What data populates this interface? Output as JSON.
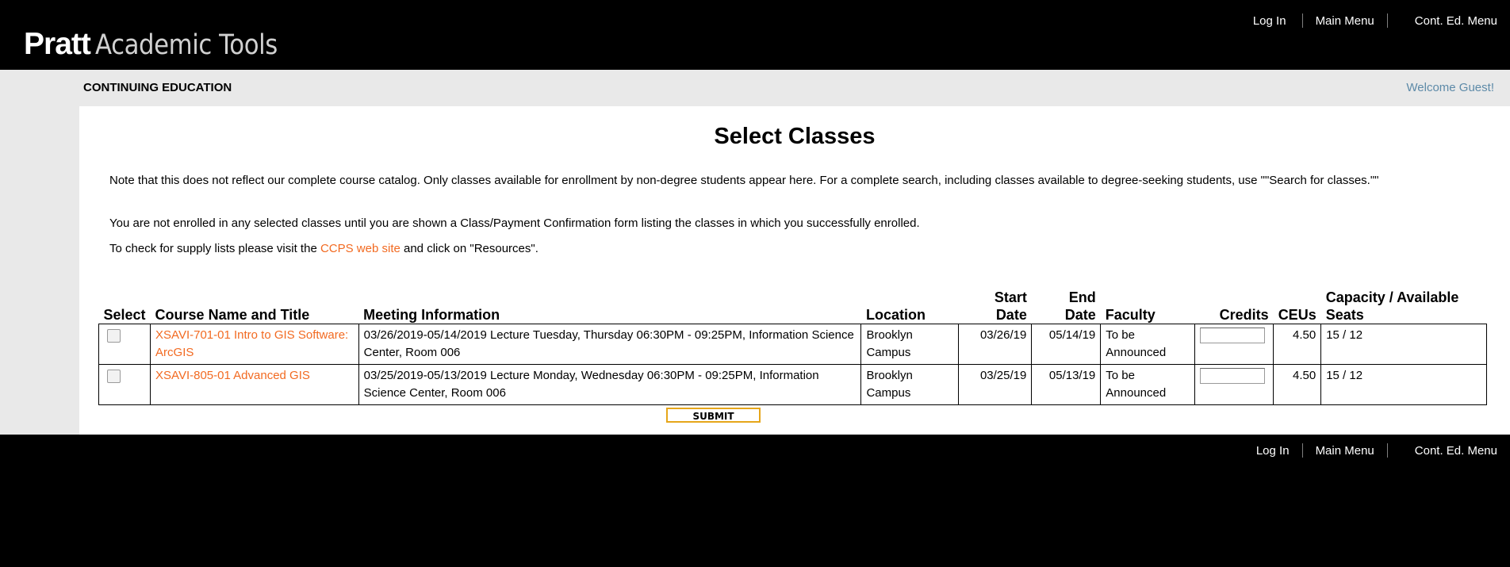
{
  "header": {
    "logo_brand": "Pratt",
    "logo_sub": "Academic Tools",
    "nav": [
      "Log In",
      "Main Menu",
      "Cont. Ed. Menu"
    ]
  },
  "subheader": {
    "section_title": "CONTINUING EDUCATION",
    "welcome": "Welcome Guest!"
  },
  "main": {
    "title": "Select Classes",
    "note": "Note that this does not reflect our complete course catalog. Only classes available for enrollment by non-degree students appear here. For a complete search, including classes available to degree-seeking students, use \"\"Search for classes.\"\"",
    "enroll_note": "You are not enrolled in any selected classes until you are shown a Class/Payment Confirmation form listing the classes in which you successfully enrolled.",
    "supply_prefix": "To check for supply lists please visit the ",
    "supply_link": "CCPS web site",
    "supply_suffix": " and click on \"Resources\"."
  },
  "table": {
    "headers": {
      "select": "Select",
      "course": "Course Name and Title",
      "meeting": "Meeting Information",
      "location": "Location",
      "start_1": "Start",
      "start_2": "Date",
      "end_1": "End",
      "end_2": "Date",
      "faculty": "Faculty",
      "credits": "Credits",
      "ceus": "CEUs",
      "capacity_1": "Capacity / Available",
      "capacity_2": "Seats"
    },
    "rows": [
      {
        "course": "XSAVI-701-01 Intro to GIS Software: ArcGIS",
        "meeting": "03/26/2019-05/14/2019 Lecture Tuesday, Thursday 06:30PM - 09:25PM, Information Science Center, Room 006",
        "location": "Brooklyn Campus",
        "start": "03/26/19",
        "end": "05/14/19",
        "faculty": "To be Announced",
        "credits": "",
        "ceus": "4.50",
        "capacity": "15 / 12"
      },
      {
        "course": "XSAVI-805-01 Advanced GIS",
        "meeting": "03/25/2019-05/13/2019 Lecture Monday, Wednesday 06:30PM - 09:25PM, Information Science Center, Room 006",
        "location": "Brooklyn Campus",
        "start": "03/25/19",
        "end": "05/13/19",
        "faculty": "To be Announced",
        "credits": "",
        "ceus": "4.50",
        "capacity": "15 / 12"
      }
    ]
  },
  "submit_label": "SUBMIT",
  "footer": {
    "nav": [
      "Log In",
      "Main Menu",
      "Cont. Ed. Menu"
    ]
  },
  "colors": {
    "link": "#f26a21",
    "welcome": "#5d8aa8",
    "submit_border": "#e6a61a"
  }
}
